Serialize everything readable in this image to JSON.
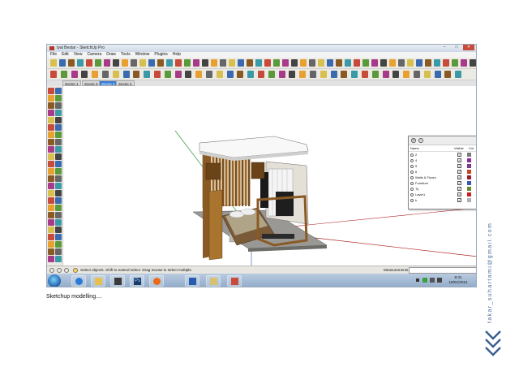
{
  "window": {
    "title": "tyal Bestar - SketchUp Pro",
    "controls": {
      "minimize": "–",
      "maximize": "□",
      "close": "✕"
    }
  },
  "menu": [
    "File",
    "Edit",
    "View",
    "Camera",
    "Draw",
    "Tools",
    "Window",
    "Plugins",
    "Help"
  ],
  "scenes": [
    {
      "label": "Scene 1",
      "active": false
    },
    {
      "label": "Scene 3",
      "active": false
    },
    {
      "label": "Scene 4",
      "active": true
    },
    {
      "label": "Scene 2",
      "active": false
    }
  ],
  "layers_panel": {
    "add_button": "+",
    "remove_button": "−",
    "columns": {
      "name": "Name",
      "visible": "Visible",
      "color": "Col"
    },
    "rows": [
      {
        "name": "2",
        "visible": "✓",
        "color": "#7a7a7a"
      },
      {
        "name": "4",
        "visible": "✓",
        "color": "#8a2c9a"
      },
      {
        "name": "5",
        "visible": "✓",
        "color": "#7a3c8a"
      },
      {
        "name": "6",
        "visible": "✓",
        "color": "#c8461e"
      },
      {
        "name": "Walls & Floors",
        "visible": "✓",
        "color": "#9b1b2a"
      },
      {
        "name": "Furniture",
        "visible": "✓",
        "color": "#3a5ab0"
      },
      {
        "name": "Ty",
        "visible": "✓",
        "color": "#6a8a30"
      },
      {
        "name": "Layer1",
        "visible": "✓",
        "color": "#c82020"
      },
      {
        "name": "k",
        "visible": "✓",
        "color": "#b0b0b0"
      }
    ]
  },
  "status_bar": {
    "hint": "Select objects. Shift to extend select. Drag mouse to select multiple.",
    "measurements_label": "Measurements",
    "measurements_value": ""
  },
  "taskbar": {
    "apps": [
      "ie-icon",
      "folder-icon",
      "media-icon",
      "photoshop-icon",
      "firefox-icon",
      "word-icon",
      "explorer-icon",
      "sketchup-icon"
    ],
    "photoshop_label": "Ps",
    "clock_time": "8:41",
    "clock_date": "19/01/2012"
  },
  "caption": "Sketchup modelling....",
  "watermark": "fakar_suhartami@gmail.com",
  "colors": {
    "axis_red": "#b02020",
    "axis_green": "#2a9a3a",
    "axis_blue": "#3050c0",
    "wood": "#8a5a24",
    "accent_blue": "#4a6d9a"
  }
}
